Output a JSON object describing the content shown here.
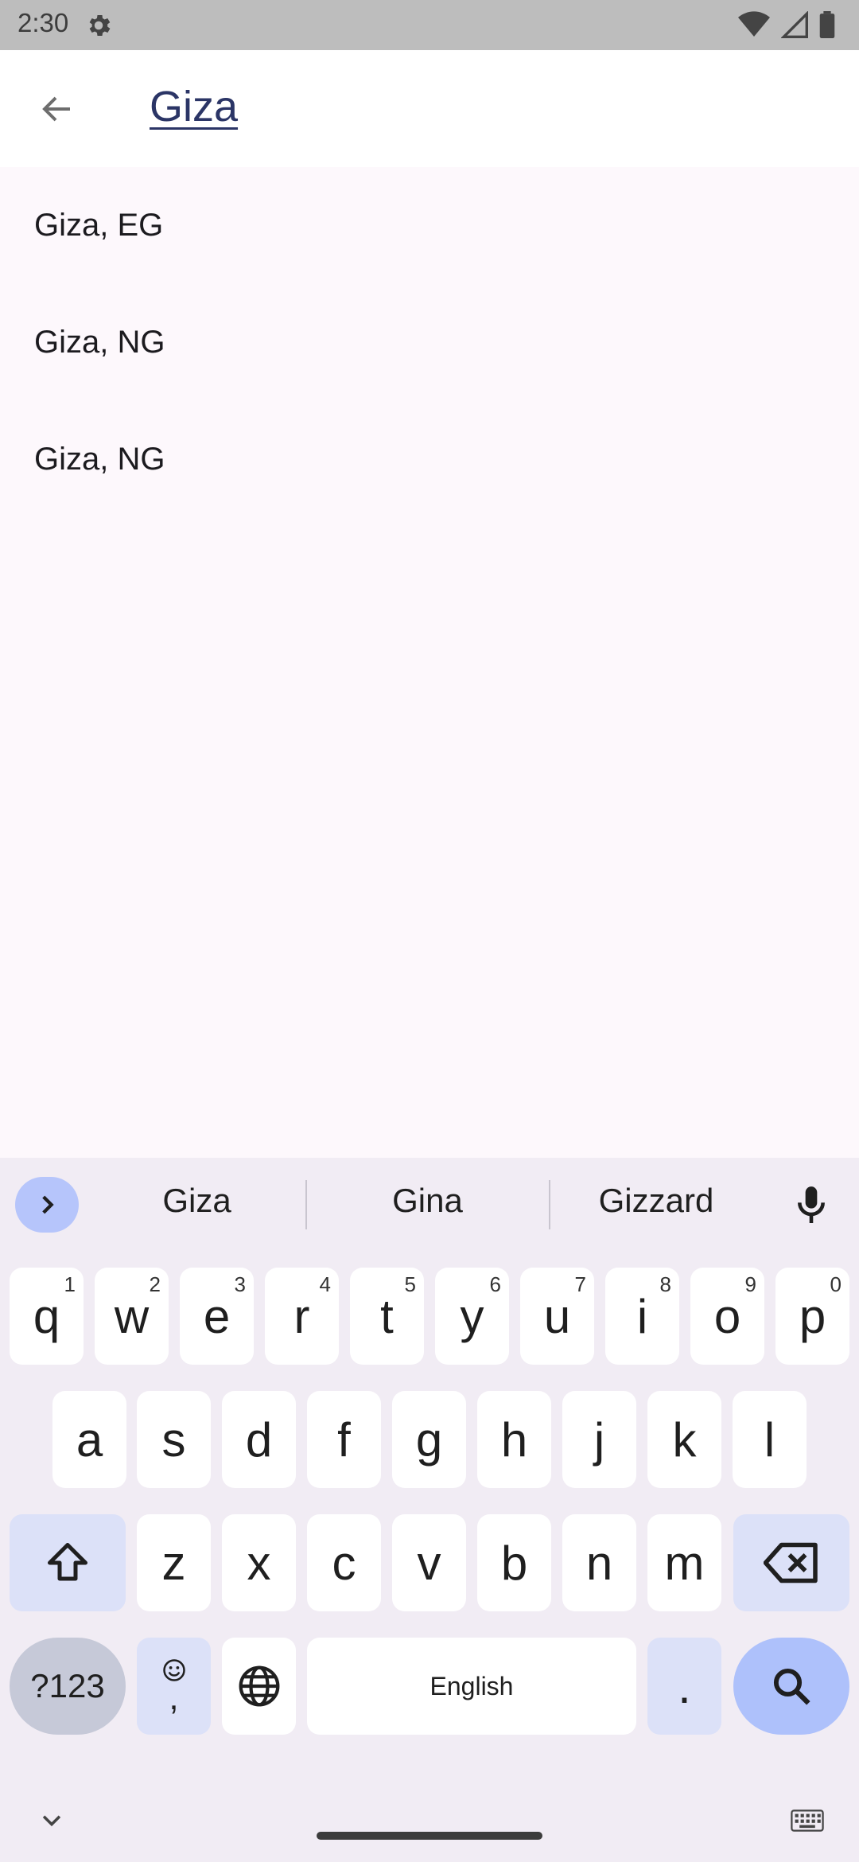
{
  "status_bar": {
    "time": "2:30",
    "icons": [
      "settings-icon",
      "wifi-icon",
      "signal-icon",
      "battery-icon"
    ]
  },
  "app_bar": {
    "back_icon": "arrow-back-icon",
    "search_text": "Giza"
  },
  "results": [
    {
      "label": "Giza, EG"
    },
    {
      "label": "Giza, NG"
    },
    {
      "label": "Giza, NG"
    }
  ],
  "keyboard": {
    "suggestions": [
      "Giza",
      "Gina",
      "Gizzard"
    ],
    "row1": [
      {
        "key": "q",
        "hint": "1"
      },
      {
        "key": "w",
        "hint": "2"
      },
      {
        "key": "e",
        "hint": "3"
      },
      {
        "key": "r",
        "hint": "4"
      },
      {
        "key": "t",
        "hint": "5"
      },
      {
        "key": "y",
        "hint": "6"
      },
      {
        "key": "u",
        "hint": "7"
      },
      {
        "key": "i",
        "hint": "8"
      },
      {
        "key": "o",
        "hint": "9"
      },
      {
        "key": "p",
        "hint": "0"
      }
    ],
    "row2": [
      "a",
      "s",
      "d",
      "f",
      "g",
      "h",
      "j",
      "k",
      "l"
    ],
    "row3": [
      "z",
      "x",
      "c",
      "v",
      "b",
      "n",
      "m"
    ],
    "symbols_label": "?123",
    "comma_label": ",",
    "space_label": "English",
    "period_label": "."
  },
  "colors": {
    "status_bar": "#bdbdbd",
    "accent": "#aec1fb",
    "search_text": "#2b3566"
  }
}
